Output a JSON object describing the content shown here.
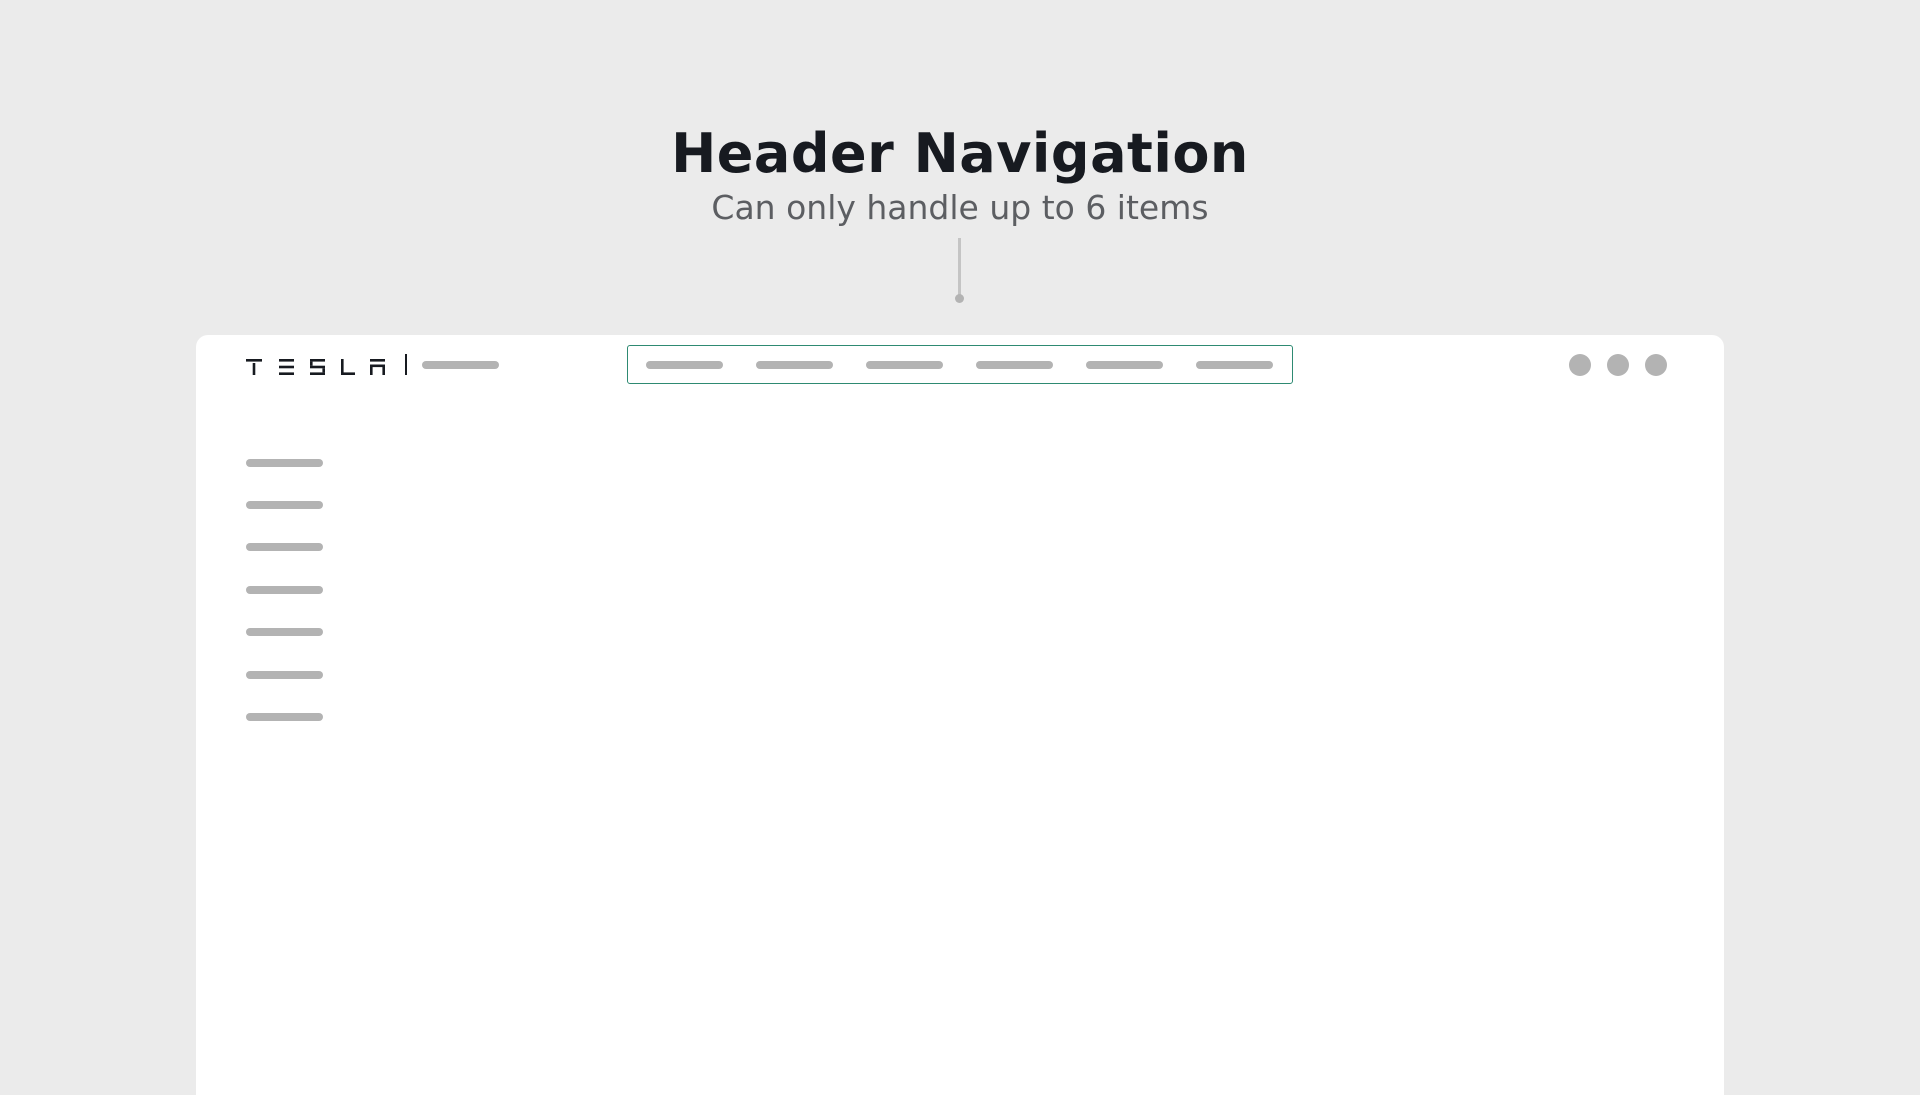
{
  "annotation": {
    "title": "Header Navigation",
    "subtitle": "Can only handle up to 6 items"
  },
  "header": {
    "logo_text": "TESLA",
    "nav_item_count": 6,
    "icon_count": 3
  },
  "sidebar": {
    "item_count": 7
  },
  "colors": {
    "background": "#ebebeb",
    "page": "#ffffff",
    "placeholder": "#b3b3b3",
    "highlight_border": "#2e8a72",
    "title_text": "#171a20",
    "subtitle_text": "#5c5e62"
  }
}
